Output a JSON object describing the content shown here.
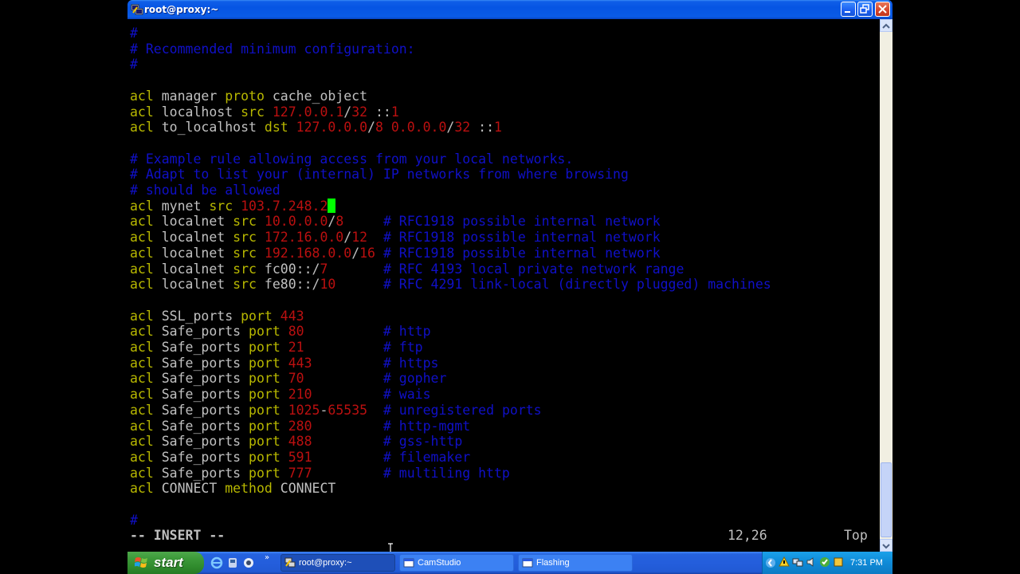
{
  "window": {
    "title": "root@proxy:~"
  },
  "terminal": {
    "lines": [
      [
        {
          "t": "#",
          "c": "cmt"
        }
      ],
      [
        {
          "t": "# Recommended minimum configuration:",
          "c": "cmt"
        }
      ],
      [
        {
          "t": "#",
          "c": "cmt"
        }
      ],
      [],
      [
        {
          "t": "acl ",
          "c": "kw"
        },
        {
          "t": "manager ",
          "c": "plain"
        },
        {
          "t": "proto ",
          "c": "kw"
        },
        {
          "t": "cache_object",
          "c": "plain"
        }
      ],
      [
        {
          "t": "acl ",
          "c": "kw"
        },
        {
          "t": "localhost ",
          "c": "plain"
        },
        {
          "t": "src ",
          "c": "kw"
        },
        {
          "t": "127.0.0.1",
          "c": "num"
        },
        {
          "t": "/",
          "c": "plain"
        },
        {
          "t": "32",
          "c": "num"
        },
        {
          "t": " ::",
          "c": "plain"
        },
        {
          "t": "1",
          "c": "num"
        }
      ],
      [
        {
          "t": "acl ",
          "c": "kw"
        },
        {
          "t": "to_localhost ",
          "c": "plain"
        },
        {
          "t": "dst ",
          "c": "kw"
        },
        {
          "t": "127.0.0.0",
          "c": "num"
        },
        {
          "t": "/",
          "c": "plain"
        },
        {
          "t": "8",
          "c": "num"
        },
        {
          "t": " ",
          "c": "plain"
        },
        {
          "t": "0.0.0.0",
          "c": "num"
        },
        {
          "t": "/",
          "c": "plain"
        },
        {
          "t": "32",
          "c": "num"
        },
        {
          "t": " ::",
          "c": "plain"
        },
        {
          "t": "1",
          "c": "num"
        }
      ],
      [],
      [
        {
          "t": "# Example rule allowing access from your local networks.",
          "c": "cmt"
        }
      ],
      [
        {
          "t": "# Adapt to list your (internal) IP networks from where browsing",
          "c": "cmt"
        }
      ],
      [
        {
          "t": "# should be allowed",
          "c": "cmt"
        }
      ],
      [
        {
          "t": "acl ",
          "c": "kw"
        },
        {
          "t": "mynet ",
          "c": "plain"
        },
        {
          "t": "src ",
          "c": "kw"
        },
        {
          "t": "103.7.248.2",
          "c": "num"
        },
        {
          "t": "",
          "c": "cursor"
        }
      ],
      [
        {
          "t": "acl ",
          "c": "kw"
        },
        {
          "t": "localnet ",
          "c": "plain"
        },
        {
          "t": "src ",
          "c": "kw"
        },
        {
          "t": "10.0.0.0",
          "c": "num"
        },
        {
          "t": "/",
          "c": "plain"
        },
        {
          "t": "8",
          "c": "num"
        },
        {
          "t": "     ",
          "c": "plain"
        },
        {
          "t": "# RFC1918 possible internal network",
          "c": "cmt"
        }
      ],
      [
        {
          "t": "acl ",
          "c": "kw"
        },
        {
          "t": "localnet ",
          "c": "plain"
        },
        {
          "t": "src ",
          "c": "kw"
        },
        {
          "t": "172.16.0.0",
          "c": "num"
        },
        {
          "t": "/",
          "c": "plain"
        },
        {
          "t": "12",
          "c": "num"
        },
        {
          "t": "  ",
          "c": "plain"
        },
        {
          "t": "# RFC1918 possible internal network",
          "c": "cmt"
        }
      ],
      [
        {
          "t": "acl ",
          "c": "kw"
        },
        {
          "t": "localnet ",
          "c": "plain"
        },
        {
          "t": "src ",
          "c": "kw"
        },
        {
          "t": "192.168.0.0",
          "c": "num"
        },
        {
          "t": "/",
          "c": "plain"
        },
        {
          "t": "16",
          "c": "num"
        },
        {
          "t": " ",
          "c": "plain"
        },
        {
          "t": "# RFC1918 possible internal network",
          "c": "cmt"
        }
      ],
      [
        {
          "t": "acl ",
          "c": "kw"
        },
        {
          "t": "localnet ",
          "c": "plain"
        },
        {
          "t": "src ",
          "c": "kw"
        },
        {
          "t": "fc00::/",
          "c": "plain"
        },
        {
          "t": "7",
          "c": "num"
        },
        {
          "t": "       ",
          "c": "plain"
        },
        {
          "t": "# RFC 4193 local private network range",
          "c": "cmt"
        }
      ],
      [
        {
          "t": "acl ",
          "c": "kw"
        },
        {
          "t": "localnet ",
          "c": "plain"
        },
        {
          "t": "src ",
          "c": "kw"
        },
        {
          "t": "fe80::/",
          "c": "plain"
        },
        {
          "t": "10",
          "c": "num"
        },
        {
          "t": "      ",
          "c": "plain"
        },
        {
          "t": "# RFC 4291 link-local (directly plugged) machines",
          "c": "cmt"
        }
      ],
      [],
      [
        {
          "t": "acl ",
          "c": "kw"
        },
        {
          "t": "SSL_ports ",
          "c": "plain"
        },
        {
          "t": "port ",
          "c": "kw"
        },
        {
          "t": "443",
          "c": "num"
        }
      ],
      [
        {
          "t": "acl ",
          "c": "kw"
        },
        {
          "t": "Safe_ports ",
          "c": "plain"
        },
        {
          "t": "port ",
          "c": "kw"
        },
        {
          "t": "80",
          "c": "num"
        },
        {
          "t": "          ",
          "c": "plain"
        },
        {
          "t": "# http",
          "c": "cmt"
        }
      ],
      [
        {
          "t": "acl ",
          "c": "kw"
        },
        {
          "t": "Safe_ports ",
          "c": "plain"
        },
        {
          "t": "port ",
          "c": "kw"
        },
        {
          "t": "21",
          "c": "num"
        },
        {
          "t": "          ",
          "c": "plain"
        },
        {
          "t": "# ftp",
          "c": "cmt"
        }
      ],
      [
        {
          "t": "acl ",
          "c": "kw"
        },
        {
          "t": "Safe_ports ",
          "c": "plain"
        },
        {
          "t": "port ",
          "c": "kw"
        },
        {
          "t": "443",
          "c": "num"
        },
        {
          "t": "         ",
          "c": "plain"
        },
        {
          "t": "# https",
          "c": "cmt"
        }
      ],
      [
        {
          "t": "acl ",
          "c": "kw"
        },
        {
          "t": "Safe_ports ",
          "c": "plain"
        },
        {
          "t": "port ",
          "c": "kw"
        },
        {
          "t": "70",
          "c": "num"
        },
        {
          "t": "          ",
          "c": "plain"
        },
        {
          "t": "# gopher",
          "c": "cmt"
        }
      ],
      [
        {
          "t": "acl ",
          "c": "kw"
        },
        {
          "t": "Safe_ports ",
          "c": "plain"
        },
        {
          "t": "port ",
          "c": "kw"
        },
        {
          "t": "210",
          "c": "num"
        },
        {
          "t": "         ",
          "c": "plain"
        },
        {
          "t": "# wais",
          "c": "cmt"
        }
      ],
      [
        {
          "t": "acl ",
          "c": "kw"
        },
        {
          "t": "Safe_ports ",
          "c": "plain"
        },
        {
          "t": "port ",
          "c": "kw"
        },
        {
          "t": "1025",
          "c": "num"
        },
        {
          "t": "-",
          "c": "plain"
        },
        {
          "t": "65535",
          "c": "num"
        },
        {
          "t": "  ",
          "c": "plain"
        },
        {
          "t": "# unregistered ports",
          "c": "cmt"
        }
      ],
      [
        {
          "t": "acl ",
          "c": "kw"
        },
        {
          "t": "Safe_ports ",
          "c": "plain"
        },
        {
          "t": "port ",
          "c": "kw"
        },
        {
          "t": "280",
          "c": "num"
        },
        {
          "t": "         ",
          "c": "plain"
        },
        {
          "t": "# http-mgmt",
          "c": "cmt"
        }
      ],
      [
        {
          "t": "acl ",
          "c": "kw"
        },
        {
          "t": "Safe_ports ",
          "c": "plain"
        },
        {
          "t": "port ",
          "c": "kw"
        },
        {
          "t": "488",
          "c": "num"
        },
        {
          "t": "         ",
          "c": "plain"
        },
        {
          "t": "# gss-http",
          "c": "cmt"
        }
      ],
      [
        {
          "t": "acl ",
          "c": "kw"
        },
        {
          "t": "Safe_ports ",
          "c": "plain"
        },
        {
          "t": "port ",
          "c": "kw"
        },
        {
          "t": "591",
          "c": "num"
        },
        {
          "t": "         ",
          "c": "plain"
        },
        {
          "t": "# filemaker",
          "c": "cmt"
        }
      ],
      [
        {
          "t": "acl ",
          "c": "kw"
        },
        {
          "t": "Safe_ports ",
          "c": "plain"
        },
        {
          "t": "port ",
          "c": "kw"
        },
        {
          "t": "777",
          "c": "num"
        },
        {
          "t": "         ",
          "c": "plain"
        },
        {
          "t": "# multiling http",
          "c": "cmt"
        }
      ],
      [
        {
          "t": "acl ",
          "c": "kw"
        },
        {
          "t": "CONNECT ",
          "c": "plain"
        },
        {
          "t": "method ",
          "c": "kw"
        },
        {
          "t": "CONNECT",
          "c": "plain"
        }
      ],
      [],
      [
        {
          "t": "#",
          "c": "cmt"
        }
      ]
    ],
    "status": {
      "mode": "-- INSERT --",
      "position": "12,26",
      "scroll": "Top"
    }
  },
  "taskbar": {
    "start_label": "start",
    "tasks": [
      {
        "label": "root@proxy:~",
        "active": true,
        "icon": "putty-icon"
      },
      {
        "label": "CamStudio",
        "active": false,
        "icon": "window-icon"
      },
      {
        "label": "Flashing",
        "active": false,
        "icon": "window-icon"
      }
    ],
    "clock": "7:31 PM"
  },
  "colors": {
    "comment": "#1010c8",
    "keyword": "#b8b800",
    "number": "#bb1010",
    "text": "#c0c0c0",
    "cursor": "#00ff00",
    "titlebar": "#0655e3",
    "taskbar": "#245edc",
    "start": "#3d9a3a"
  }
}
